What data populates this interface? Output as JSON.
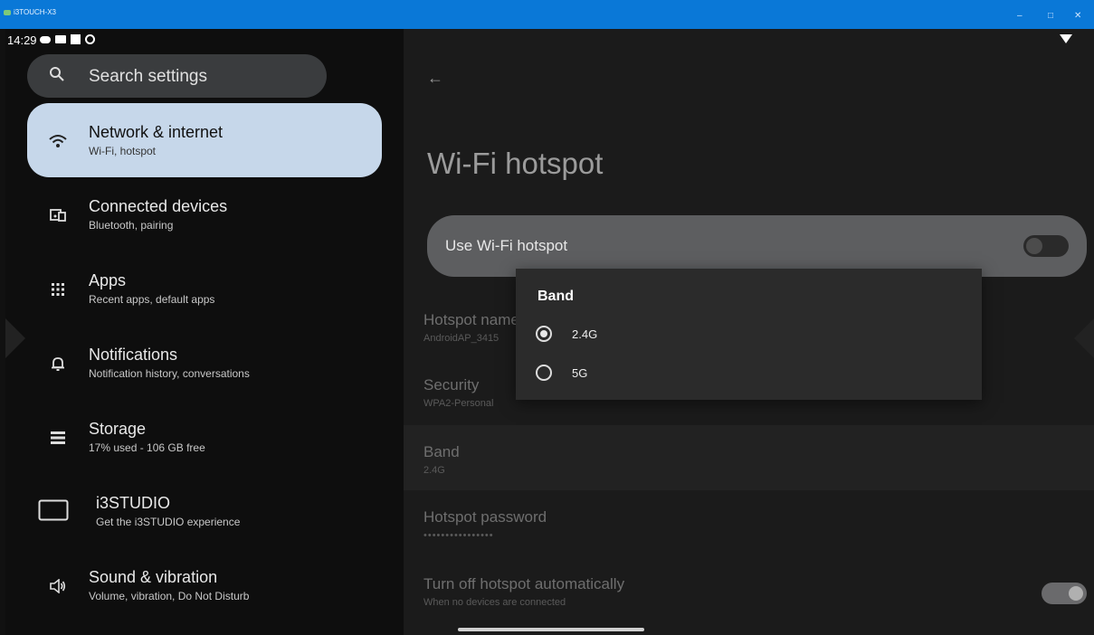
{
  "window": {
    "title": "i3TOUCH-X3",
    "minimize": "–",
    "maximize": "□",
    "close": "✕"
  },
  "status": {
    "time": "14:29"
  },
  "search": {
    "placeholder": "Search settings"
  },
  "sidebar": {
    "items": [
      {
        "title": "Network & internet",
        "subtitle": "Wi-Fi, hotspot",
        "icon": "wifi-icon"
      },
      {
        "title": "Connected devices",
        "subtitle": "Bluetooth, pairing",
        "icon": "devices-icon"
      },
      {
        "title": "Apps",
        "subtitle": "Recent apps, default apps",
        "icon": "apps-grid-icon"
      },
      {
        "title": "Notifications",
        "subtitle": "Notification history, conversations",
        "icon": "bell-icon"
      },
      {
        "title": "Storage",
        "subtitle": "17% used - 106 GB free",
        "icon": "storage-icon"
      },
      {
        "title": "i3STUDIO",
        "subtitle": "Get the i3STUDIO experience",
        "icon": "monitor-icon"
      },
      {
        "title": "Sound & vibration",
        "subtitle": "Volume, vibration, Do Not Disturb",
        "icon": "speaker-icon"
      }
    ]
  },
  "detail": {
    "back": "←",
    "title": "Wi-Fi hotspot",
    "use_hotspot": "Use Wi-Fi hotspot",
    "hotspot_name": {
      "title": "Hotspot name",
      "value": "AndroidAP_3415"
    },
    "security": {
      "title": "Security",
      "value": "WPA2-Personal"
    },
    "band": {
      "title": "Band",
      "value": "2.4G"
    },
    "password": {
      "title": "Hotspot password",
      "value": "••••••••••••••••"
    },
    "auto_off": {
      "title": "Turn off hotspot automatically",
      "subtitle": "When no devices are connected"
    }
  },
  "dialog": {
    "title": "Band",
    "options": [
      {
        "label": "2.4G",
        "selected": true
      },
      {
        "label": "5G",
        "selected": false
      }
    ]
  }
}
